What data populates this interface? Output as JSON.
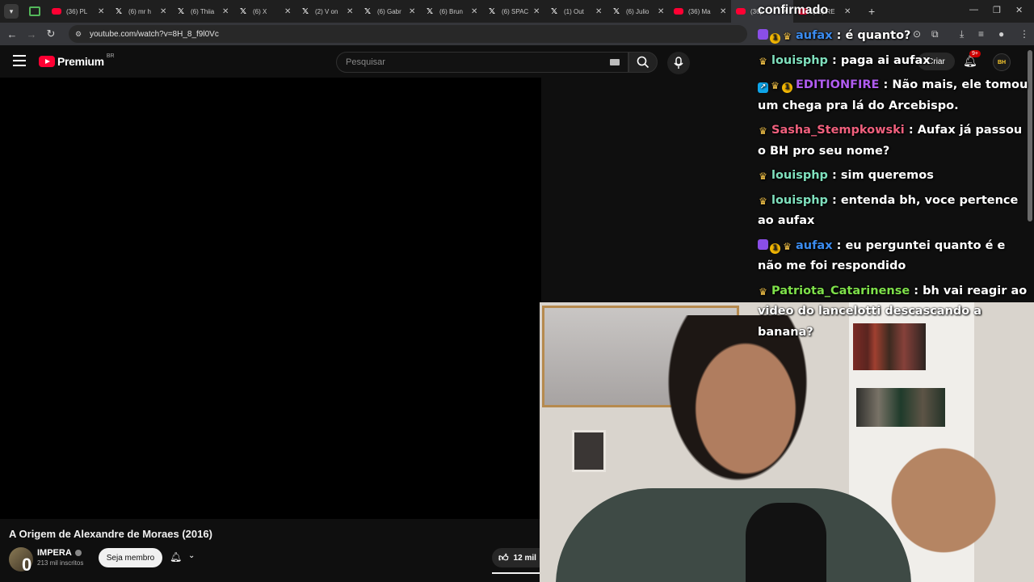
{
  "browser": {
    "tabs": [
      {
        "favicon": "youtube",
        "title": "(36) PL"
      },
      {
        "favicon": "x",
        "title": "(6) mr h"
      },
      {
        "favicon": "x",
        "title": "(6) Thiia"
      },
      {
        "favicon": "x",
        "title": "(6) X"
      },
      {
        "favicon": "x",
        "title": "(2) V on"
      },
      {
        "favicon": "x",
        "title": "(6) Gabr"
      },
      {
        "favicon": "x",
        "title": "(6) Brun"
      },
      {
        "favicon": "x",
        "title": "(6) SPAC"
      },
      {
        "favicon": "x",
        "title": "(1) Out"
      },
      {
        "favicon": "x",
        "title": "(6) Julio"
      },
      {
        "favicon": "youtube",
        "title": "(36) Ma"
      },
      {
        "favicon": "youtube",
        "title": "(36)"
      },
      {
        "favicon": "youtube",
        "title": "(36) RE"
      }
    ],
    "new_tab": "+",
    "url": "youtube.com/watch?v=8H_8_f9l0Vc"
  },
  "youtube": {
    "logo_text": "Premium",
    "country": "BR",
    "search_placeholder": "Pesquisar",
    "create_label": "Criar",
    "notification_count": "9+",
    "avatar_text": "BH"
  },
  "video": {
    "title": "A Origem de Alexandre de Moraes (2016)",
    "channel_name": "IMPERA",
    "channel_avatar_glyph": "0",
    "subscribers": "213 mil inscritos",
    "member_label": "Seja membro",
    "likes": "12 mil"
  },
  "chat": {
    "header": "confirmado",
    "messages": [
      {
        "badges": [
          "sub",
          "one",
          "crown"
        ],
        "user": "aufax",
        "color": "#3b8cf0",
        "text": ": é quanto?"
      },
      {
        "badges": [
          "crown"
        ],
        "user": "louisphp",
        "color": "#7fe0bd",
        "text": ": paga ai aufax"
      },
      {
        "badges": [
          "prime",
          "crown",
          "one"
        ],
        "user": "EDITIONFIRE",
        "color": "#b05cf0",
        "text": ": Não mais, ele tomou um chega pra lá do Arcebispo."
      },
      {
        "badges": [
          "crown"
        ],
        "user": "Sasha_Stempkowski",
        "color": "#f0607d",
        "text": ": Aufax já passou o BH pro seu nome?"
      },
      {
        "badges": [
          "crown"
        ],
        "user": "louisphp",
        "color": "#7fe0bd",
        "text": ": sim queremos"
      },
      {
        "badges": [
          "crown"
        ],
        "user": "louisphp",
        "color": "#7fe0bd",
        "text": ": entenda bh, voce pertence ao aufax"
      },
      {
        "badges": [
          "sub",
          "one",
          "crown"
        ],
        "user": "aufax",
        "color": "#3b8cf0",
        "text": ": eu perguntei quanto é e não me foi respondido"
      },
      {
        "badges": [
          "crown"
        ],
        "user": "Patriota_Catarinense",
        "color": "#7ee04a",
        "text": ": bh vai reagir ao video do lancelotti descascando a banana?"
      }
    ]
  }
}
